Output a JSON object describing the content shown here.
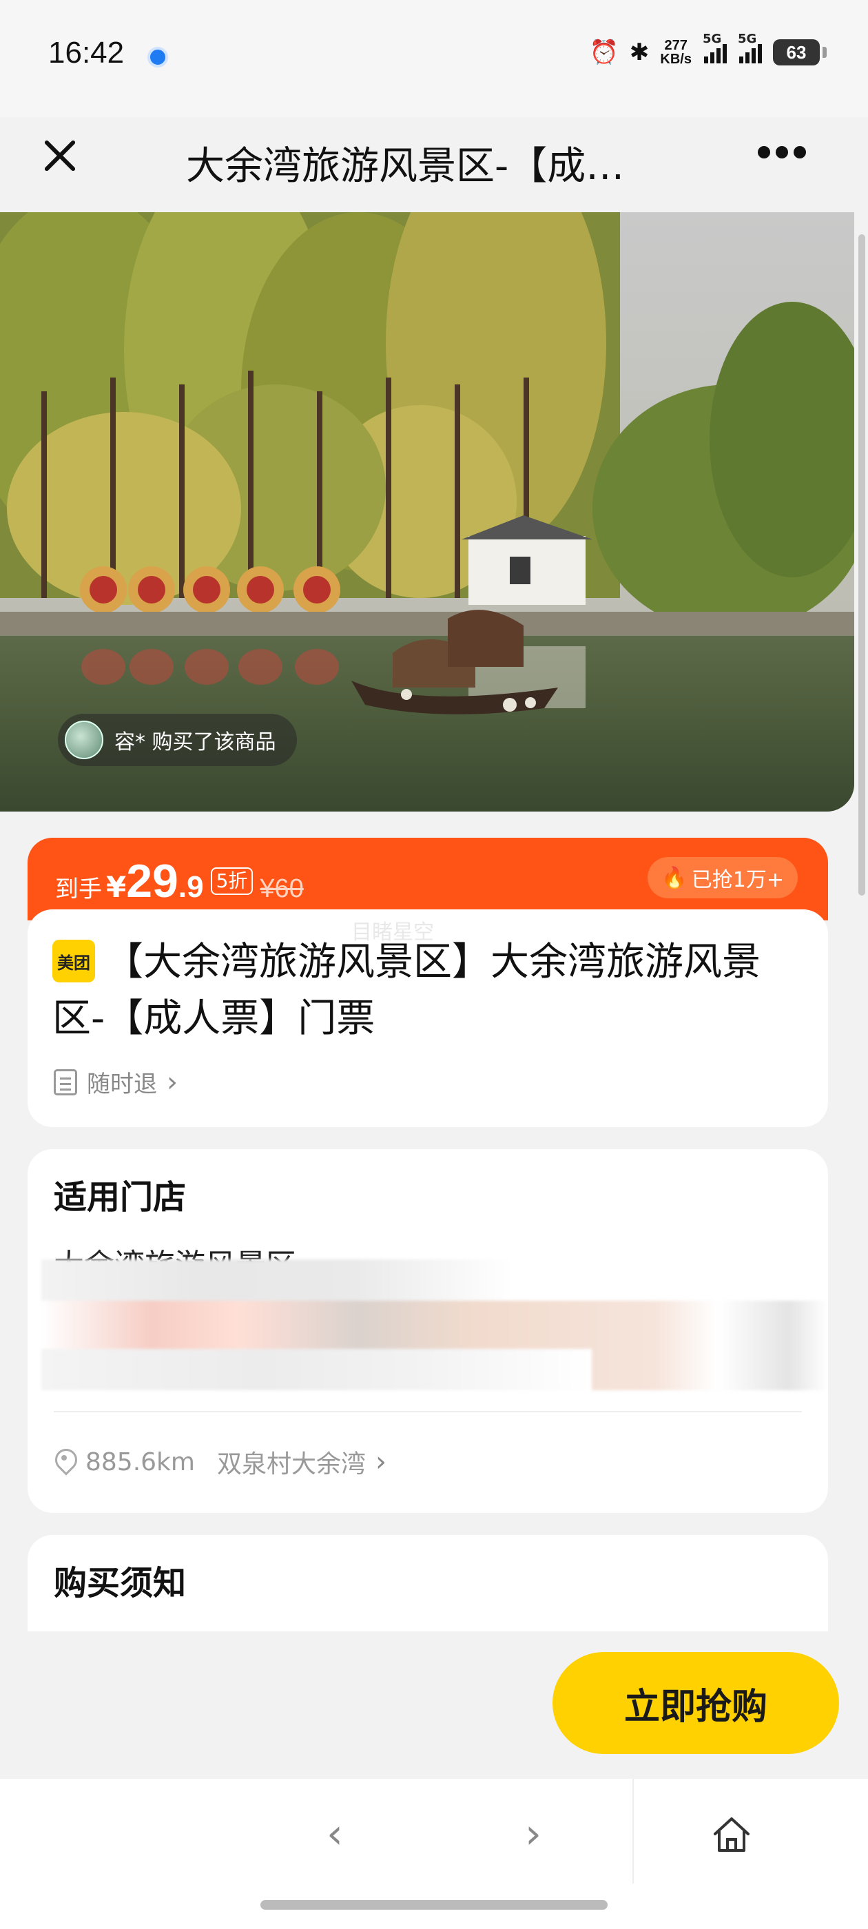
{
  "status_bar": {
    "time": "16:42",
    "net_speed_value": "277",
    "net_speed_unit": "KB/s",
    "signal1_label": "5G",
    "signal2_label": "5G",
    "battery": "63"
  },
  "nav": {
    "title": "大余湾旅游风景区-【成…"
  },
  "hero": {
    "buyer_text": "容* 购买了该商品"
  },
  "price": {
    "label": "到手",
    "currency": "¥",
    "integer": "29",
    "decimal": ".9",
    "discount": "5折",
    "original": "¥60",
    "sold": "已抢1万+"
  },
  "product": {
    "watermark": "目睹星空",
    "brand_badge": "美团",
    "title": "【大余湾旅游风景区】大余湾旅游风景区-【成人票】门票",
    "refund": "随时退"
  },
  "stores": {
    "heading": "适用门店",
    "name": "大余湾旅游风景区",
    "distance": "885.6km",
    "address": "双泉村大余湾"
  },
  "notice": {
    "heading": "购买须知"
  },
  "actions": {
    "buy": "立即抢购"
  },
  "colors": {
    "accent_orange": "#ff5416",
    "buy_yellow": "#ffd100"
  }
}
